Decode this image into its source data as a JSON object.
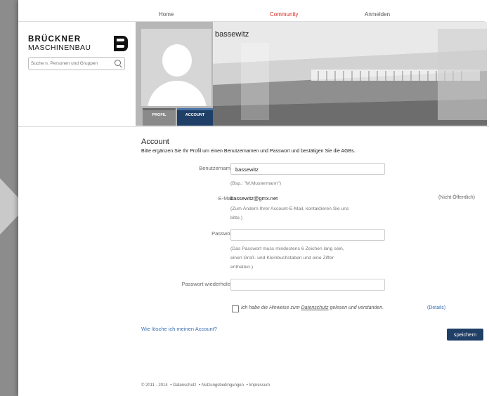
{
  "topnav": {
    "home": "Home",
    "community": "Community",
    "anmelden": "Anmelden"
  },
  "brand": {
    "line1": "BRÜCKNER",
    "line2": "MASCHINENBAU"
  },
  "search": {
    "placeholder": "Suche n. Personen und Gruppen"
  },
  "profile": {
    "username": "bassewitz",
    "tabs": [
      "PROFIL",
      "ACCOUNT"
    ],
    "active_tab": "ACCOUNT"
  },
  "account": {
    "title": "Account",
    "intro": "Bitte ergänzen Sie Ihr Profil um einen Benutzernamen und Passwort und bestätigen Sie die AGBs.",
    "username_label": "Benutzername",
    "username_value": "bassewitz",
    "username_hint": "(Bsp.: \"M.Mustermann\")",
    "email_label": "E-Mail",
    "email_value": "bassewitz@gmx.net",
    "email_hint_1": "(Zum Ändern Ihrer Account-E-Mail, kontaktieren Sie uns",
    "email_hint_2": "bitte.)",
    "email_visibility": "(Nicht Öffentlich)",
    "password_label": "Passwort",
    "password_hint_1": "(Das Passwort muss mindestens 6 Zeichen lang sein,",
    "password_hint_2": "einen Groß- und Kleinbuchstaben und eine Ziffer",
    "password_hint_3": "enthalten.)",
    "password_repeat_label": "Passwort wiederholen",
    "agree_pre": "Ich habe die Hinweise zum ",
    "agree_link": "Datenschutz",
    "agree_post": " gelesen und verstanden.",
    "details_link": "(Details)",
    "delete_link": "Wie lösche ich meinen Account?",
    "save_label": "speichern"
  },
  "footer": {
    "copyright": "© 2011 - 2014",
    "links": [
      "• Datenschutz",
      "• Nutzungsbedingungen",
      "• Impressum"
    ]
  },
  "colors": {
    "accent_red": "#d9261c",
    "accent_navy": "#1f3f66",
    "link_blue": "#3a6fb0"
  }
}
